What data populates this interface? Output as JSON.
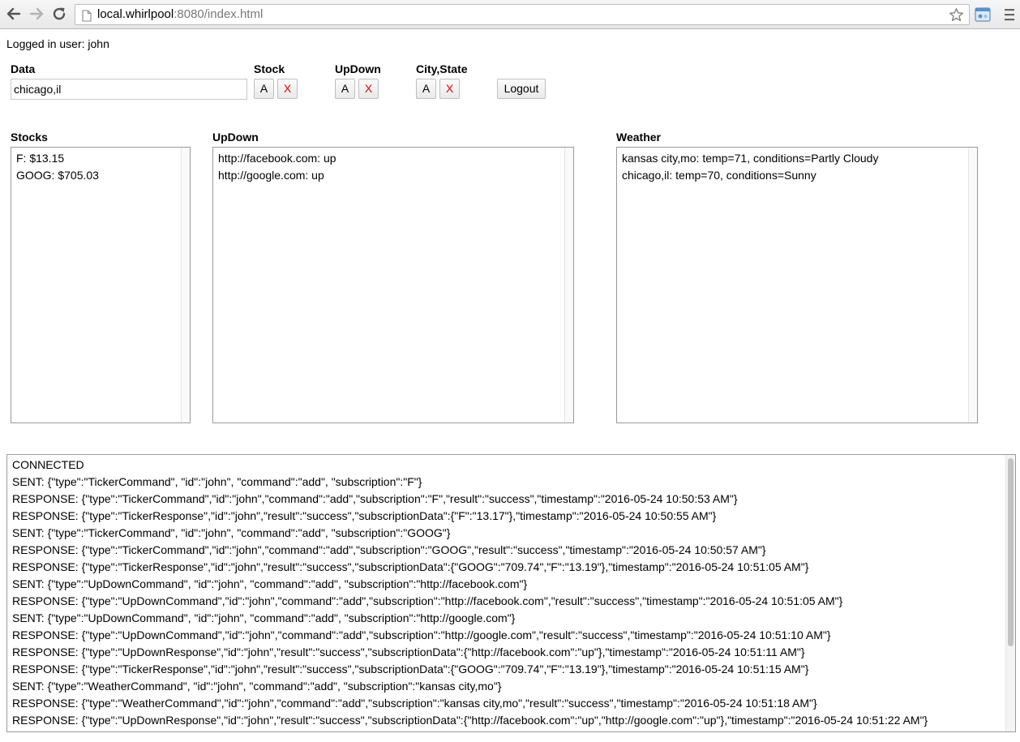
{
  "browser": {
    "url_host": "local.whirlpool",
    "url_rest": ":8080/index.html"
  },
  "user_line": "Logged in user: john",
  "controls": {
    "data_label": "Data",
    "data_value": "chicago,il",
    "stock_label": "Stock",
    "updown_label": "UpDown",
    "citystate_label": "City,State",
    "add_label": "A",
    "remove_label": "X",
    "logout_label": "Logout"
  },
  "panels": {
    "stocks": {
      "title": "Stocks",
      "items": [
        "F: $13.15",
        "GOOG: $705.03"
      ]
    },
    "updown": {
      "title": "UpDown",
      "items": [
        "http://facebook.com: up",
        "http://google.com: up"
      ]
    },
    "weather": {
      "title": "Weather",
      "items": [
        "kansas city,mo: temp=71, conditions=Partly Cloudy",
        "chicago,il: temp=70, conditions=Sunny"
      ]
    }
  },
  "log": [
    "CONNECTED",
    "SENT: {\"type\":\"TickerCommand\", \"id\":\"john\", \"command\":\"add\", \"subscription\":\"F\"}",
    "RESPONSE: {\"type\":\"TickerCommand\",\"id\":\"john\",\"command\":\"add\",\"subscription\":\"F\",\"result\":\"success\",\"timestamp\":\"2016-05-24 10:50:53 AM\"}",
    "RESPONSE: {\"type\":\"TickerResponse\",\"id\":\"john\",\"result\":\"success\",\"subscriptionData\":{\"F\":\"13.17\"},\"timestamp\":\"2016-05-24 10:50:55 AM\"}",
    "SENT: {\"type\":\"TickerCommand\", \"id\":\"john\", \"command\":\"add\", \"subscription\":\"GOOG\"}",
    "RESPONSE: {\"type\":\"TickerCommand\",\"id\":\"john\",\"command\":\"add\",\"subscription\":\"GOOG\",\"result\":\"success\",\"timestamp\":\"2016-05-24 10:50:57 AM\"}",
    "RESPONSE: {\"type\":\"TickerResponse\",\"id\":\"john\",\"result\":\"success\",\"subscriptionData\":{\"GOOG\":\"709.74\",\"F\":\"13.19\"},\"timestamp\":\"2016-05-24 10:51:05 AM\"}",
    "SENT: {\"type\":\"UpDownCommand\", \"id\":\"john\", \"command\":\"add\", \"subscription\":\"http://facebook.com\"}",
    "RESPONSE: {\"type\":\"UpDownCommand\",\"id\":\"john\",\"command\":\"add\",\"subscription\":\"http://facebook.com\",\"result\":\"success\",\"timestamp\":\"2016-05-24 10:51:05 AM\"}",
    "SENT: {\"type\":\"UpDownCommand\", \"id\":\"john\", \"command\":\"add\", \"subscription\":\"http://google.com\"}",
    "RESPONSE: {\"type\":\"UpDownCommand\",\"id\":\"john\",\"command\":\"add\",\"subscription\":\"http://google.com\",\"result\":\"success\",\"timestamp\":\"2016-05-24 10:51:10 AM\"}",
    "RESPONSE: {\"type\":\"UpDownResponse\",\"id\":\"john\",\"result\":\"success\",\"subscriptionData\":{\"http://facebook.com\":\"up\"},\"timestamp\":\"2016-05-24 10:51:11 AM\"}",
    "RESPONSE: {\"type\":\"TickerResponse\",\"id\":\"john\",\"result\":\"success\",\"subscriptionData\":{\"GOOG\":\"709.74\",\"F\":\"13.19\"},\"timestamp\":\"2016-05-24 10:51:15 AM\"}",
    "SENT: {\"type\":\"WeatherCommand\", \"id\":\"john\", \"command\":\"add\", \"subscription\":\"kansas city,mo\"}",
    "RESPONSE: {\"type\":\"WeatherCommand\",\"id\":\"john\",\"command\":\"add\",\"subscription\":\"kansas city,mo\",\"result\":\"success\",\"timestamp\":\"2016-05-24 10:51:18 AM\"}",
    "RESPONSE: {\"type\":\"UpDownResponse\",\"id\":\"john\",\"result\":\"success\",\"subscriptionData\":{\"http://facebook.com\":\"up\",\"http://google.com\":\"up\"},\"timestamp\":\"2016-05-24 10:51:22 AM\"}"
  ]
}
